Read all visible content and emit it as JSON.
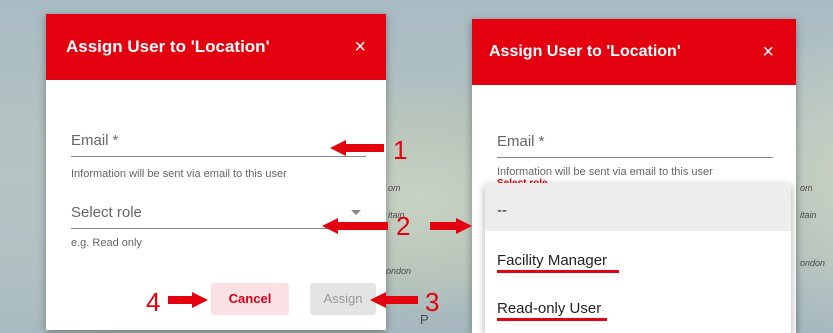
{
  "colors": {
    "accent": "#e3000f",
    "cancel_bg": "#fbe1e3",
    "assign_bg": "#e4e4e4"
  },
  "map_labels": {
    "m1": "om",
    "m2": "itain",
    "m3": "ondon",
    "m4": "P",
    "m5": "om",
    "m6": "itain",
    "m7": "ondon"
  },
  "left_dialog": {
    "title": "Assign User to 'Location'",
    "close_icon": "×",
    "email_label": "Email *",
    "email_helper": "Information will be sent via email to this user",
    "role_placeholder": "Select role",
    "role_helper": "e.g. Read only",
    "cancel_label": "Cancel",
    "assign_label": "Assign"
  },
  "right_dialog": {
    "title": "Assign User to 'Location'",
    "close_icon": "×",
    "email_label": "Email *",
    "email_helper": "Information will be sent via email to this user",
    "error_text": "Select role",
    "dropdown_options": [
      "--",
      "Facility Manager",
      "Read-only User"
    ]
  },
  "annotations": [
    "1",
    "2",
    "3",
    "4"
  ]
}
